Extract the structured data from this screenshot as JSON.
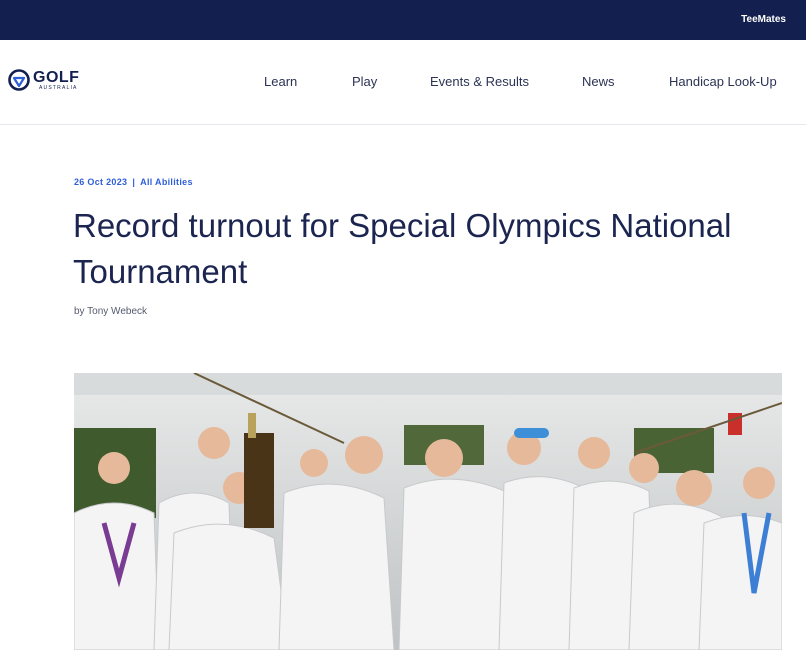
{
  "topbar": {
    "link_label": "TeeMates"
  },
  "brand": {
    "name": "GOLF",
    "subtitle": "AUSTRALIA",
    "logo_icon": "golf-australia-logo"
  },
  "nav": {
    "items": [
      {
        "label": "Learn"
      },
      {
        "label": "Play"
      },
      {
        "label": "Events & Results"
      },
      {
        "label": "News"
      },
      {
        "label": "Handicap Look-Up"
      }
    ]
  },
  "article": {
    "date": "26 Oct 2023",
    "separator": "|",
    "category": "All Abilities",
    "title": "Record turnout for Special Olympics National Tournament",
    "byline": "by Tony Webeck",
    "hero_image": "Group of Special Olympics golfers in white polo shirts celebrating and holding up a trophy"
  },
  "colors": {
    "topbar_bg": "#13204f",
    "accent_blue": "#2f5fd8",
    "title_text": "#1b2550"
  }
}
